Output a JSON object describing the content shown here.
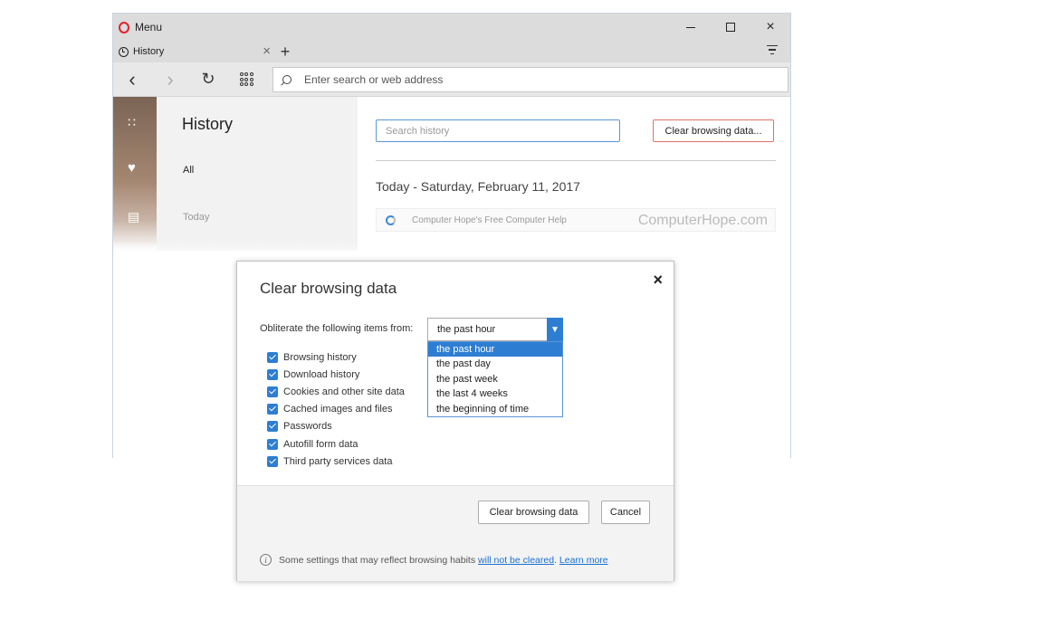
{
  "browser": {
    "menu_label": "Menu",
    "tab_title": "History",
    "tab_close": "×",
    "new_tab": "+",
    "address_placeholder": "Enter search or web address",
    "win_close": "×"
  },
  "history": {
    "title": "History",
    "filter_all": "All",
    "filter_today": "Today",
    "search_placeholder": "Search history",
    "clear_button": "Clear browsing data...",
    "date_heading": "Today - Saturday, February 11, 2017",
    "entry_title": "Computer Hope's Free Computer Help",
    "watermark": "ComputerHope.com"
  },
  "dialog": {
    "title": "Clear browsing data",
    "close": "×",
    "from_label": "Obliterate the following items from:",
    "selected_range": "the past hour",
    "range_options": [
      "the past hour",
      "the past day",
      "the past week",
      "the last 4 weeks",
      "the beginning of time"
    ],
    "checkboxes": [
      {
        "label": "Browsing history",
        "checked": true
      },
      {
        "label": "Download history",
        "checked": true
      },
      {
        "label": "Cookies and other site data",
        "checked": true
      },
      {
        "label": "Cached images and files",
        "checked": true
      },
      {
        "label": "Passwords",
        "checked": true
      },
      {
        "label": "Autofill form data",
        "checked": true
      },
      {
        "label": "Third party services data",
        "checked": true
      }
    ],
    "clear_button": "Clear browsing data",
    "cancel_button": "Cancel",
    "info_text": "Some settings that may reflect browsing habits",
    "info_link1": "will not be cleared",
    "info_period": ".",
    "info_link2": "Learn more"
  },
  "colors": {
    "accent": "#2d7ed3",
    "clear_button_border": "#e0706a",
    "opera_red": "#e0242f"
  }
}
